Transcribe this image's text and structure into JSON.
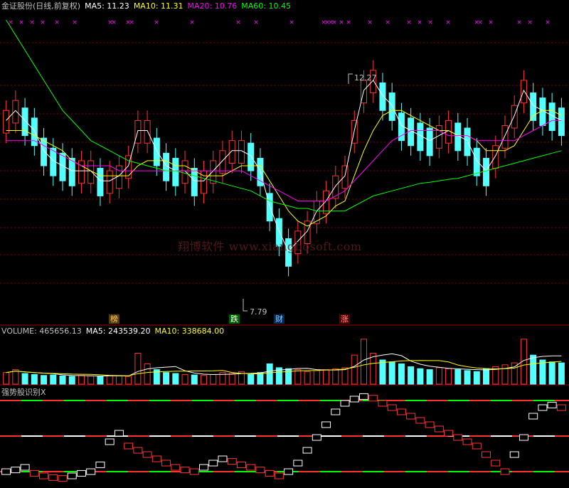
{
  "header": {
    "name": "金证股份(日线,前复权)",
    "ma5": "MA5: 11.23",
    "ma10": "MA10: 11.31",
    "ma20": "MA20: 10.76",
    "ma60": "MA60: 10.45"
  },
  "volume_header": {
    "volume": "VOLUME: 465656.13",
    "ma5": "MA5: 243539.20",
    "ma10": "MA10: 338684.00"
  },
  "indicator_title": "强势股识别X",
  "watermark": "翔博软件 www.xiangbosoft.com",
  "annotations": {
    "high": "12.27",
    "low": "7.79",
    "tag_bang": "榜",
    "tag_die": "跌",
    "tag_cai": "财",
    "tag_zhang": "涨"
  },
  "colors": {
    "up": "#ff3232",
    "down": "#54ffff",
    "ma5": "#ffffff",
    "ma10": "#ffff00",
    "ma20": "#ff00ff",
    "ma60": "#00ff00",
    "grid": "#800000",
    "marker": "#ff00ff"
  },
  "chart_data": [
    {
      "type": "candlestick",
      "ylim": [
        7.2,
        13.4
      ],
      "series": [
        {
          "name": "MA5",
          "values": [
            11.2,
            11.4,
            11.2,
            11.0,
            10.6,
            10.4,
            10.3,
            10.2,
            10.2,
            10.2,
            10.0,
            10.0,
            10.1,
            10.3,
            11.0,
            11.0,
            10.6,
            10.3,
            10.2,
            10.2,
            10.0,
            10.0,
            10.2,
            10.4,
            10.6,
            10.6,
            10.5,
            10.2,
            9.5,
            9.0,
            8.6,
            8.8,
            9.0,
            9.4,
            9.6,
            9.9,
            10.1,
            11.0,
            11.8,
            12.0,
            11.7,
            11.5,
            11.1,
            11.0,
            10.9,
            10.8,
            10.9,
            11.0,
            10.9,
            10.8,
            10.4,
            10.2,
            10.5,
            10.9,
            11.3,
            11.8,
            11.5,
            11.4,
            11.3,
            11.2
          ]
        },
        {
          "name": "MA10",
          "values": [
            11.0,
            11.0,
            11.0,
            10.9,
            10.8,
            10.7,
            10.6,
            10.4,
            10.3,
            10.2,
            10.1,
            10.1,
            10.1,
            10.1,
            10.3,
            10.4,
            10.4,
            10.4,
            10.3,
            10.3,
            10.2,
            10.1,
            10.1,
            10.1,
            10.2,
            10.3,
            10.3,
            10.3,
            10.0,
            9.7,
            9.4,
            9.2,
            9.1,
            9.2,
            9.3,
            9.5,
            9.6,
            10.1,
            10.6,
            11.0,
            11.3,
            11.4,
            11.4,
            11.3,
            11.2,
            11.1,
            11.0,
            11.0,
            10.9,
            10.9,
            10.8,
            10.6,
            10.6,
            10.6,
            10.7,
            11.0,
            11.3,
            11.4,
            11.4,
            11.3
          ]
        },
        {
          "name": "MA20",
          "values": [
            10.8,
            10.8,
            10.8,
            10.8,
            10.7,
            10.6,
            10.5,
            10.4,
            10.3,
            10.3,
            10.3,
            10.3,
            10.2,
            10.2,
            10.2,
            10.2,
            10.2,
            10.2,
            10.2,
            10.2,
            10.2,
            10.2,
            10.2,
            10.2,
            10.2,
            10.2,
            10.1,
            10.0,
            9.9,
            9.8,
            9.7,
            9.6,
            9.6,
            9.6,
            9.6,
            9.7,
            9.8,
            10.0,
            10.2,
            10.4,
            10.6,
            10.8,
            10.9,
            11.0,
            11.0,
            11.0,
            11.0,
            10.9,
            10.9,
            10.9,
            10.8,
            10.8,
            10.8,
            10.8,
            10.8,
            10.9,
            11.0,
            11.1,
            11.2,
            11.2
          ]
        },
        {
          "name": "MA60",
          "values": [
            13.2,
            12.9,
            12.6,
            12.3,
            12.0,
            11.7,
            11.4,
            11.2,
            11.0,
            10.8,
            10.7,
            10.6,
            10.5,
            10.4,
            10.35,
            10.3,
            10.25,
            10.2,
            10.2,
            10.15,
            10.1,
            10.05,
            10.0,
            9.95,
            9.9,
            9.85,
            9.8,
            9.7,
            9.6,
            9.55,
            9.5,
            9.45,
            9.45,
            9.4,
            9.4,
            9.4,
            9.4,
            9.5,
            9.6,
            9.7,
            9.75,
            9.8,
            9.85,
            9.9,
            9.95,
            9.97,
            10.0,
            10.03,
            10.05,
            10.1,
            10.15,
            10.2,
            10.25,
            10.3,
            10.35,
            10.4,
            10.45,
            10.5,
            10.55,
            10.6
          ]
        }
      ]
    },
    {
      "type": "bar",
      "title": "VOLUME",
      "ylim": [
        0,
        500000
      ],
      "values": [
        120000,
        150000,
        110000,
        100000,
        90000,
        95000,
        85000,
        80000,
        90000,
        85000,
        80000,
        90000,
        85000,
        80000,
        320000,
        210000,
        150000,
        120000,
        110000,
        100000,
        95000,
        90000,
        100000,
        120000,
        110000,
        130000,
        100000,
        120000,
        210000,
        170000,
        160000,
        150000,
        130000,
        140000,
        150000,
        160000,
        170000,
        300000,
        465000,
        320000,
        250000,
        230000,
        210000,
        180000,
        160000,
        150000,
        170000,
        160000,
        150000,
        140000,
        130000,
        160000,
        180000,
        200000,
        220000,
        465000,
        300000,
        250000,
        230000,
        220000
      ]
    },
    {
      "type": "line",
      "title": "强势股识别X",
      "ylim": [
        0,
        100
      ],
      "series": [
        {
          "name": "",
          "values": [
            10,
            12,
            15,
            8,
            5,
            3,
            2,
            5,
            8,
            10,
            18,
            45,
            55,
            40,
            35,
            30,
            25,
            20,
            15,
            12,
            10,
            15,
            20,
            25,
            22,
            18,
            15,
            12,
            8,
            5,
            10,
            20,
            35,
            50,
            65,
            80,
            90,
            95,
            98,
            96,
            90,
            85,
            80,
            75,
            70,
            65,
            60,
            55,
            50,
            45,
            40,
            30,
            20,
            10,
            30,
            50,
            75,
            85,
            88,
            85
          ]
        }
      ]
    }
  ]
}
